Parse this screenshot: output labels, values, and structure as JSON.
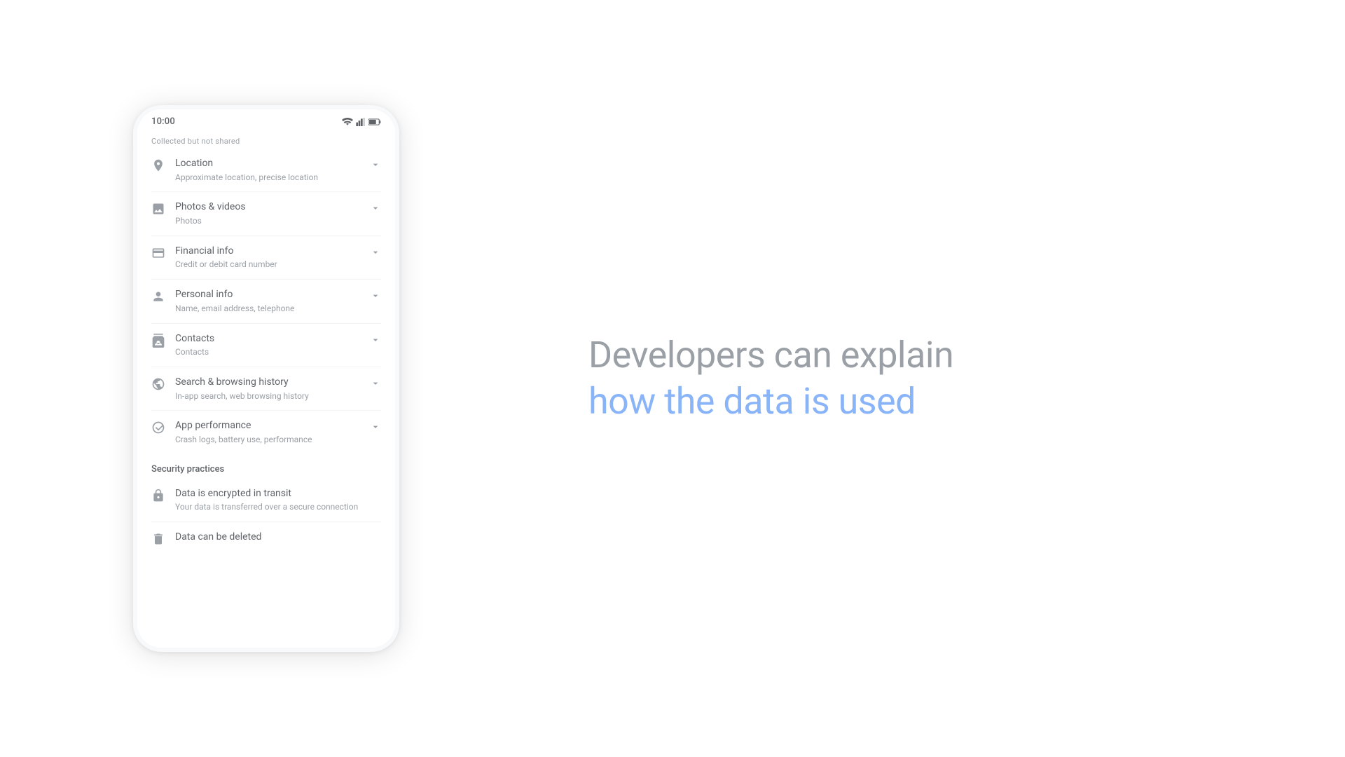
{
  "status_bar": {
    "time": "10:00"
  },
  "collected_section": {
    "label": "Collected but not shared"
  },
  "data_items": [
    {
      "id": "location",
      "title": "Location",
      "subtitle": "Approximate location, precise location",
      "icon": "location"
    },
    {
      "id": "photos-videos",
      "title": "Photos & videos",
      "subtitle": "Photos",
      "icon": "photo"
    },
    {
      "id": "financial-info",
      "title": "Financial info",
      "subtitle": "Credit or debit card number",
      "icon": "credit-card"
    },
    {
      "id": "personal-info",
      "title": "Personal info",
      "subtitle": "Name, email address, telephone",
      "icon": "person"
    },
    {
      "id": "contacts",
      "title": "Contacts",
      "subtitle": "Contacts",
      "icon": "contacts"
    },
    {
      "id": "search-browsing",
      "title": "Search & browsing history",
      "subtitle": "In-app search, web browsing history",
      "icon": "globe"
    },
    {
      "id": "app-performance",
      "title": "App performance",
      "subtitle": "Crash logs, battery use, performance",
      "icon": "performance"
    }
  ],
  "security_section": {
    "label": "Security practices",
    "items": [
      {
        "id": "encrypted",
        "title": "Data is encrypted in transit",
        "subtitle": "Your data is transferred over a secure connection",
        "icon": "lock"
      },
      {
        "id": "deletable",
        "title": "Data can be deleted",
        "subtitle": "",
        "icon": "trash"
      }
    ]
  },
  "headline": {
    "dark_text": "Developers can explain",
    "blue_text": "how the data is used"
  }
}
